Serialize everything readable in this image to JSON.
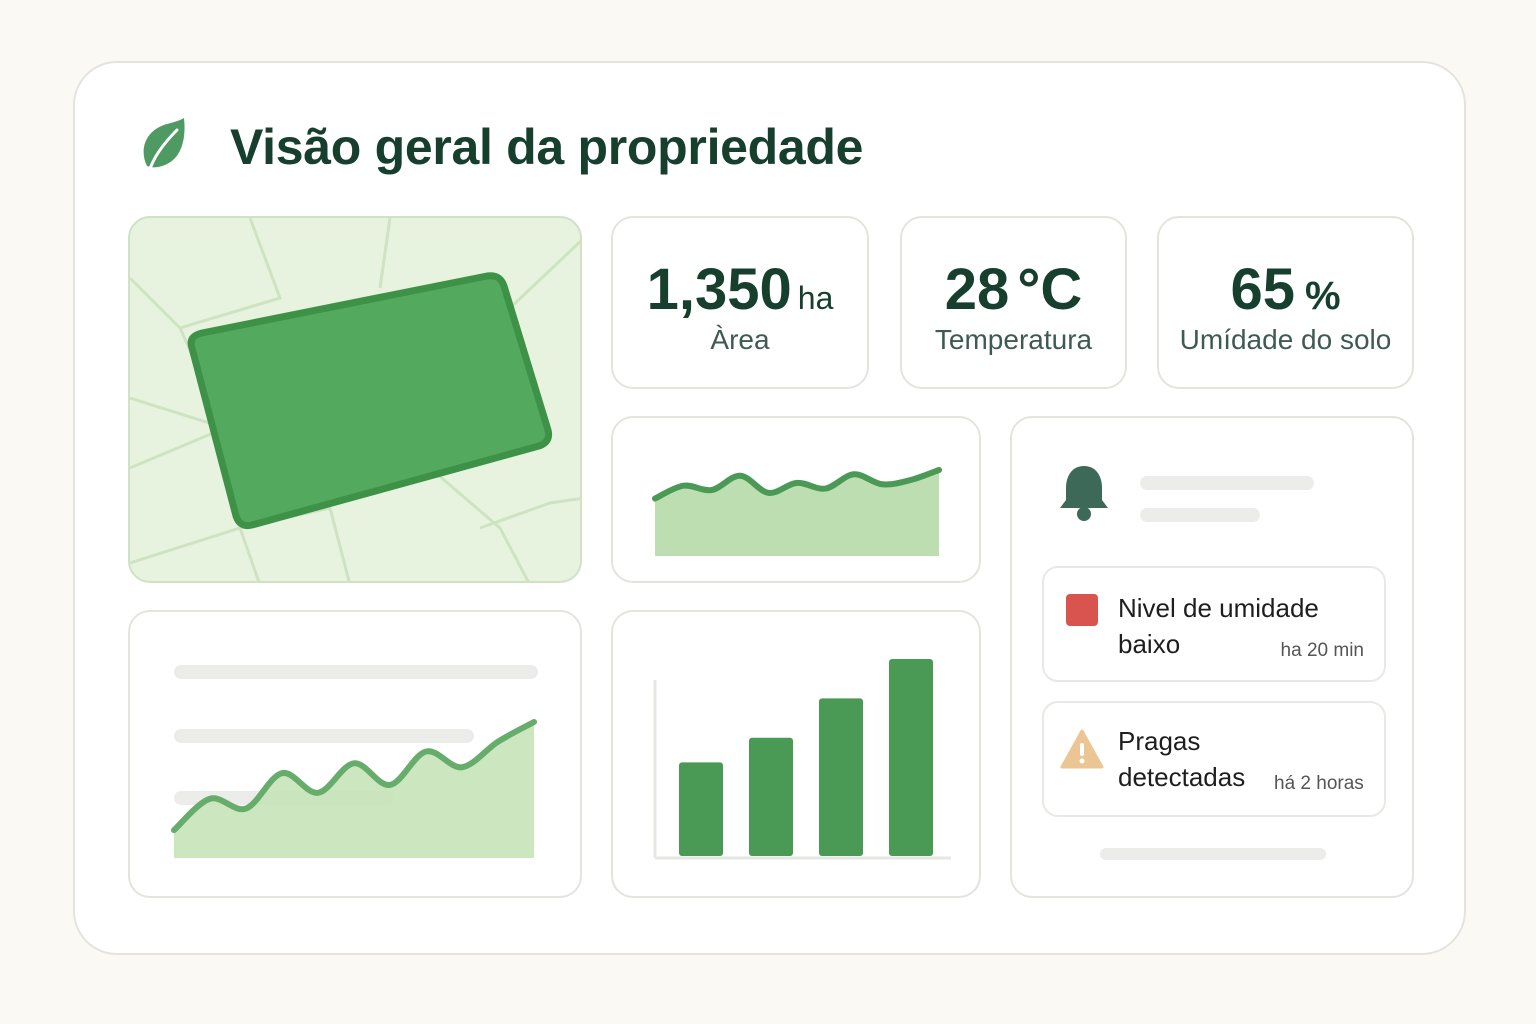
{
  "header": {
    "title": "Visão geral da propriedade",
    "icon": "leaf-icon"
  },
  "stats": [
    {
      "value": "1,350",
      "unit": "ha",
      "label": "Àrea"
    },
    {
      "value": "28",
      "unit": "°C",
      "label": "Temperatura"
    },
    {
      "value": "65",
      "unit": "%",
      "label": "Umídade do solo"
    }
  ],
  "notifications": {
    "icon": "bell-icon",
    "alerts": [
      {
        "text": "Nivel de umidade baixo",
        "time": "ha 20 min",
        "icon": "red-square-icon",
        "color": "#d9534f"
      },
      {
        "text": "Pragas detectadas",
        "time": "há 2 horas",
        "icon": "warning-triangle-icon",
        "color": "#ecc595"
      }
    ]
  },
  "colors": {
    "accent": "#4a9a55",
    "title": "#173f2e",
    "area_fill": "#bcdeb0",
    "map_bg": "#e8f3df"
  },
  "chart_data": [
    {
      "type": "area",
      "series": [
        {
          "values": [
            30,
            48,
            42,
            62,
            38,
            52,
            44,
            64,
            50,
            56,
            70
          ]
        }
      ]
    },
    {
      "type": "bar",
      "values": [
        95,
        120,
        160,
        200
      ]
    },
    {
      "type": "area",
      "series": [
        {
          "values": [
            10,
            42,
            32,
            68,
            48,
            78,
            56,
            90,
            74,
            100,
            120
          ]
        }
      ]
    }
  ]
}
